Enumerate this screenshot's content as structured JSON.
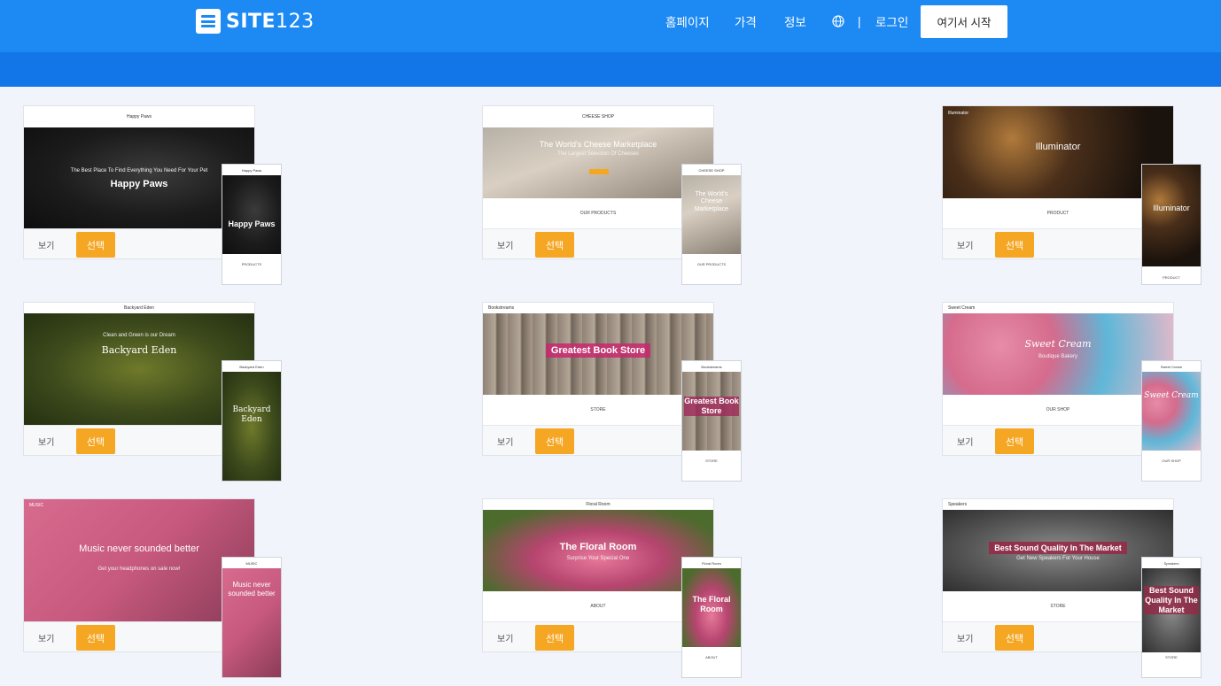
{
  "header": {
    "logo_bold": "SITE",
    "logo_num": "123",
    "nav": {
      "home": "홈페이지",
      "price": "가격",
      "info": "정보",
      "separator": "|",
      "login": "로그인",
      "start": "여기서 시작"
    },
    "globe_icon": "globe-icon"
  },
  "card_actions": {
    "view": "보기",
    "select": "선택"
  },
  "templates": [
    {
      "brand": "Happy Paws",
      "tagline": "The Best Place To Find Everything You Need For Your Pet",
      "title": "Happy Paws",
      "section": "PRODUCTS"
    },
    {
      "brand": "CHEESE SHOP",
      "title": "The World's Cheese Marketplace",
      "tagline": "The Largest Selection Of Cheeses",
      "section": "OUR PRODUCTS"
    },
    {
      "brand": "Illuminator",
      "title": "Illuminator",
      "section": "PRODUCT"
    },
    {
      "brand": "Backyard Eden",
      "tagline": "Clean and Green is our Dream",
      "title": "Backyard Eden",
      "section": ""
    },
    {
      "brand": "Bookstreams",
      "title": "Greatest Book Store",
      "section": "STORE"
    },
    {
      "brand": "Sweet Cream",
      "title": "Sweet Cream",
      "tagline": "Boutique Bakery",
      "section": "OUR SHOP"
    },
    {
      "brand": "MUSIC",
      "title": "Music never sounded better",
      "tagline": "Get your headphones on sale now!",
      "section": ""
    },
    {
      "brand": "Floral Room",
      "title": "The Floral Room",
      "tagline": "Surprise Your Special One",
      "section": "ABOUT"
    },
    {
      "brand": "Speakers",
      "title": "Best Sound Quality In The Market",
      "tagline": "Get New Speakers For Your House",
      "section": "STORE"
    }
  ],
  "colors": {
    "header": "#1d8af4",
    "subbar": "#1376e8",
    "select_button": "#f5a623",
    "page_bg": "#f1f5fb"
  }
}
